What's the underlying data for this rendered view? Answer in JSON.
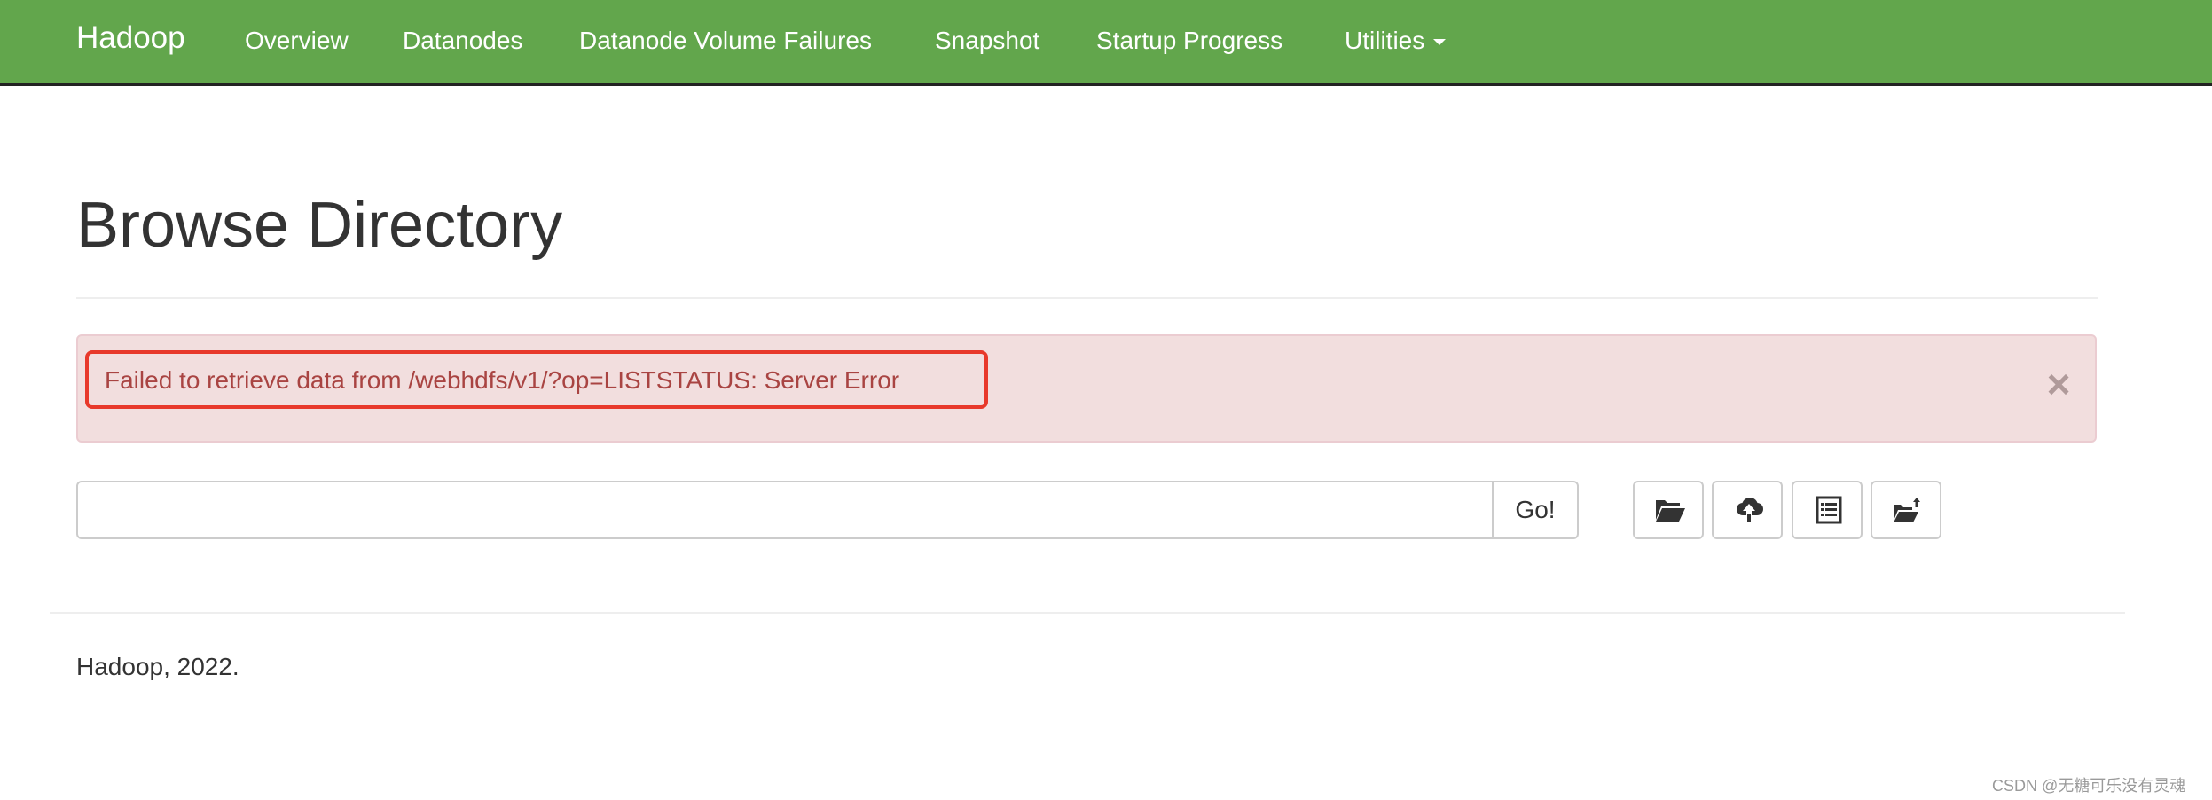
{
  "navbar": {
    "brand": "Hadoop",
    "items": [
      {
        "label": "Overview"
      },
      {
        "label": "Datanodes"
      },
      {
        "label": "Datanode Volume Failures"
      },
      {
        "label": "Snapshot"
      },
      {
        "label": "Startup Progress"
      },
      {
        "label": "Utilities"
      }
    ]
  },
  "page": {
    "title": "Browse Directory"
  },
  "alert": {
    "message": "Failed to retrieve data from /webhdfs/v1/?op=LISTSTATUS: Server Error",
    "close_glyph": "×"
  },
  "browser": {
    "path_value": "",
    "go_label": "Go!",
    "icons": [
      "folder-open-icon",
      "cloud-upload-icon",
      "list-alt-icon",
      "folder-move-icon"
    ]
  },
  "footer": {
    "text": "Hadoop, 2022."
  },
  "watermark": "CSDN @无糖可乐没有灵魂",
  "colors": {
    "navbar_bg": "#62a64c",
    "alert_bg": "#f2dede",
    "alert_text": "#a94442",
    "highlight_border": "#e8392b"
  }
}
